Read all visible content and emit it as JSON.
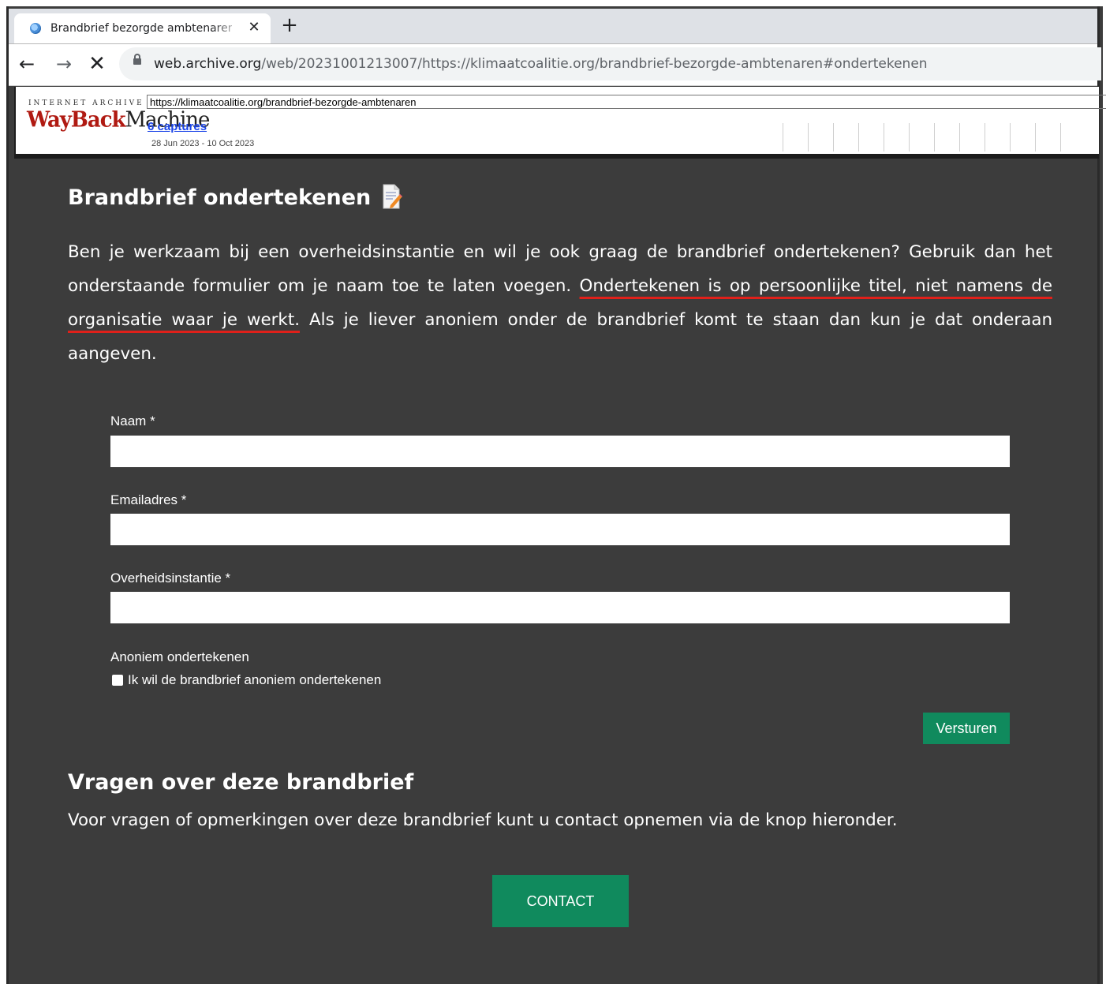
{
  "browser": {
    "tab_title": "Brandbrief bezorgde ambtenaren",
    "tab_close": "✕",
    "new_tab": "+",
    "back": "←",
    "forward": "→",
    "stop": "✕",
    "url_host": "web.archive.org",
    "url_rest": "/web/20231001213007/https://klimaatcoalitie.org/brandbrief-bezorgde-ambtenaren#ondertekenen"
  },
  "wayback": {
    "ia_label": "INTERNET ARCHIVE",
    "logo_wayback": "WayBack",
    "logo_machine": "Machine",
    "url_value": "https://klimaatcoalitie.org/brandbrief-bezorgde-ambtenaren",
    "captures": "6 captures",
    "range": "28 Jun 2023 - 10 Oct 2023"
  },
  "page": {
    "heading": "Brandbrief ondertekenen",
    "intro_before": "Ben je werkzaam bij een overheidsinstantie en wil je ook graag de brandbrief ondertekenen? Gebruik dan het onderstaande formulier om je naam toe te laten voegen. ",
    "intro_underlined": "Ondertekenen is op persoonlijke titel, niet namens de organisatie waar je werkt.",
    "intro_after": " Als je liever anoniem onder de brandbrief komt te staan dan kun je dat onderaan aangeven.",
    "form": {
      "name_label": "Naam *",
      "email_label": "Emailadres *",
      "org_label": "Overheidsinstantie *",
      "anon_label": "Anoniem ondertekenen",
      "anon_checkbox_label": "Ik wil de brandbrief anoniem ondertekenen",
      "submit_label": "Versturen"
    },
    "questions_heading": "Vragen over deze brandbrief",
    "questions_text": "Voor vragen of opmerkingen over deze brandbrief kunt u contact opnemen via de knop hieronder.",
    "contact_label": "CONTACT"
  },
  "colors": {
    "background": "#3c3c3c",
    "button_green": "#108a5d",
    "underline_red": "#e0201a",
    "wayback_red": "#b01a12",
    "link_blue": "#1a44e8"
  },
  "icons": [
    "globe-favicon-icon",
    "close-icon",
    "plus-icon",
    "back-arrow-icon",
    "forward-arrow-icon",
    "stop-icon",
    "lock-icon",
    "document-edit-icon"
  ]
}
